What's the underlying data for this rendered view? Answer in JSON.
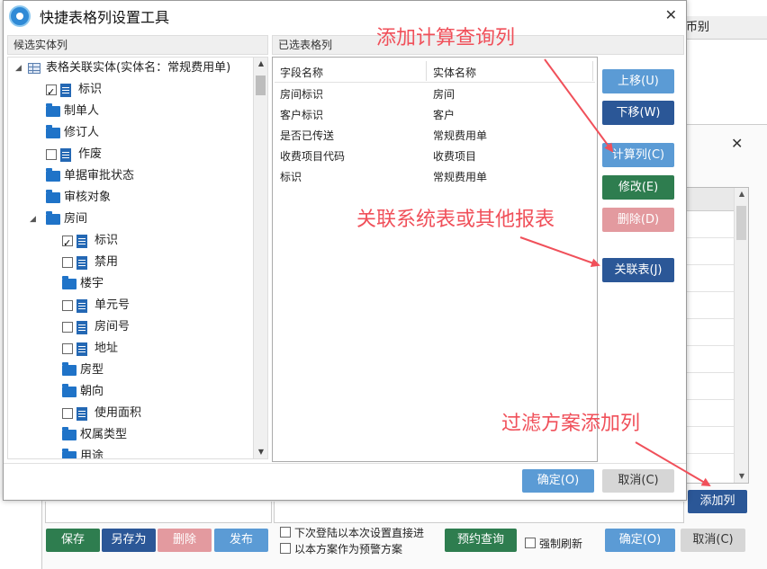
{
  "background": {
    "header_label": "币别",
    "buttons": {
      "save": "保存",
      "save_as": "另存为",
      "delete": "删除",
      "publish": "发布",
      "reserve_query": "预约查询",
      "add_column": "添加列",
      "ok": "确定(O)",
      "cancel": "取消(C)"
    },
    "options": {
      "direct_next_login": "下次登陆以本次设置直接进",
      "as_warning_plan": "以本方案作为预警方案",
      "force_refresh": "强制刷新"
    },
    "close_symbol": "✕"
  },
  "dialog": {
    "title": "快捷表格列设置工具",
    "close_symbol": "✕",
    "left_header": "候选实体列",
    "right_header": "已选表格列",
    "tree": [
      {
        "label": "表格关联实体(实体名：常规费用单)",
        "type": "root",
        "level": 0,
        "expanded": true
      },
      {
        "label": "标识",
        "type": "field",
        "level": 1,
        "checked": true
      },
      {
        "label": "制单人",
        "type": "folder",
        "level": 1
      },
      {
        "label": "修订人",
        "type": "folder",
        "level": 1
      },
      {
        "label": "作废",
        "type": "field",
        "level": 1,
        "checked": false
      },
      {
        "label": "单据审批状态",
        "type": "folder",
        "level": 1
      },
      {
        "label": "审核对象",
        "type": "folder",
        "level": 1
      },
      {
        "label": "房间",
        "type": "folder-open",
        "level": 1,
        "expanded": true
      },
      {
        "label": "标识",
        "type": "field",
        "level": 2,
        "checked": true
      },
      {
        "label": "禁用",
        "type": "field",
        "level": 2,
        "checked": false
      },
      {
        "label": "楼宇",
        "type": "folder",
        "level": 2
      },
      {
        "label": "单元号",
        "type": "field",
        "level": 2,
        "checked": false
      },
      {
        "label": "房间号",
        "type": "field",
        "level": 2,
        "checked": false
      },
      {
        "label": "地址",
        "type": "field",
        "level": 2,
        "checked": false
      },
      {
        "label": "房型",
        "type": "folder",
        "level": 2
      },
      {
        "label": "朝向",
        "type": "folder",
        "level": 2
      },
      {
        "label": "使用面积",
        "type": "field",
        "level": 2,
        "checked": false
      },
      {
        "label": "权属类型",
        "type": "folder",
        "level": 2
      },
      {
        "label": "用途",
        "type": "folder",
        "level": 2
      }
    ],
    "columns": [
      "字段名称",
      "实体名称"
    ],
    "rows": [
      [
        "房间标识",
        "房间"
      ],
      [
        "客户标识",
        "客户"
      ],
      [
        "是否已传送",
        "常规费用单"
      ],
      [
        "收费项目代码",
        "收费项目"
      ],
      [
        "标识",
        "常规费用单"
      ]
    ],
    "side_buttons": {
      "move_up": "上移(U)",
      "move_down": "下移(W)",
      "calc_column": "计算列(C)",
      "modify": "修改(E)",
      "delete": "删除(D)",
      "related_table": "关联表(J)"
    },
    "footer": {
      "ok": "确定(O)",
      "cancel": "取消(C)"
    }
  },
  "annotations": {
    "add_calc_query_column": "添加计算查询列",
    "link_system_tables": "关联系统表或其他报表",
    "filter_plan_add_column": "过滤方案添加列"
  },
  "colors": {
    "green": "#2e7d4f",
    "navy": "#2b5797",
    "pink": "#e39a9f",
    "blue": "#5b9bd5",
    "annotation_red": "#f0505a"
  }
}
